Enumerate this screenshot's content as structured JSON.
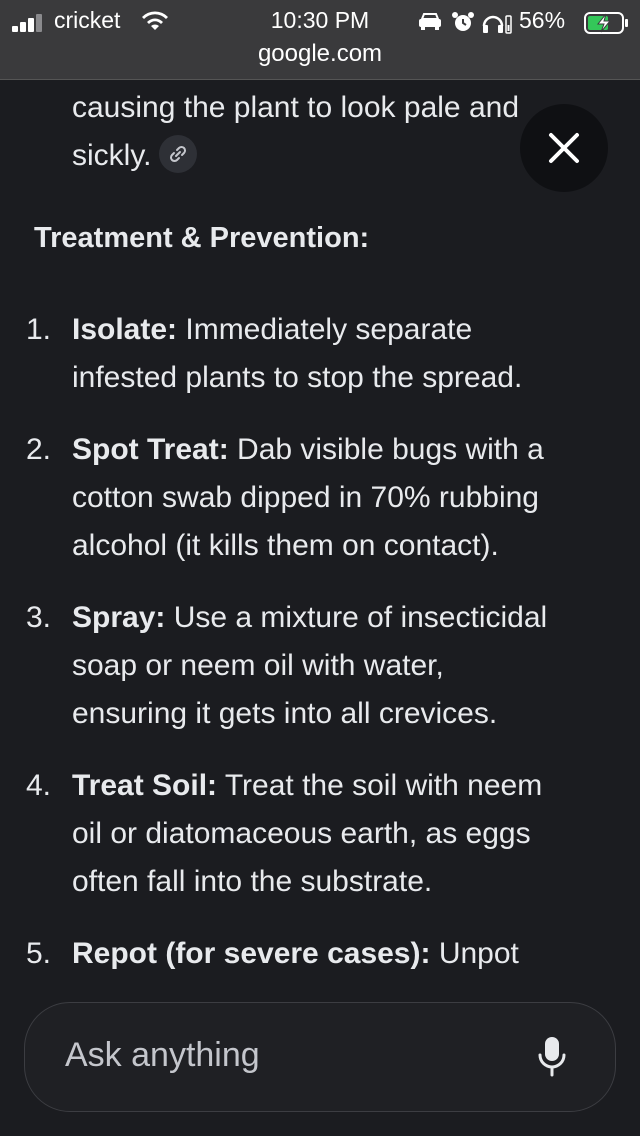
{
  "status_bar": {
    "carrier": "cricket",
    "time": "10:30 PM",
    "battery_percent": "56%",
    "battery_charging": true,
    "url": "google.com",
    "icons": [
      "signal-icon",
      "wifi-icon",
      "car-icon",
      "alarm-icon",
      "headphones-icon",
      "battery-icon"
    ]
  },
  "content": {
    "intro_lines": [
      "causing the plant to look pale and",
      "sickly."
    ],
    "section_heading": "Treatment & Prevention:",
    "items": [
      {
        "number": "1.",
        "title": "Isolate:",
        "lines": [
          " Immediately separate",
          "infested plants to stop the spread."
        ]
      },
      {
        "number": "2.",
        "title": "Spot Treat:",
        "lines": [
          " Dab visible bugs with a",
          "cotton swab dipped in 70% rubbing",
          "alcohol (it kills them on contact)."
        ]
      },
      {
        "number": "3.",
        "title": "Spray:",
        "lines": [
          " Use a mixture of insecticidal",
          "soap or neem oil with water,",
          "ensuring it gets into all crevices."
        ]
      },
      {
        "number": "4.",
        "title": "Treat Soil:",
        "lines": [
          " Treat the soil with neem",
          "oil or diatomaceous earth, as eggs",
          "often fall into the substrate."
        ]
      },
      {
        "number": "5.",
        "title": "Repot (for severe cases):",
        "lines": [
          " Unpot"
        ]
      }
    ]
  },
  "composer": {
    "placeholder": "Ask anything"
  },
  "colors": {
    "background": "#1b1c20",
    "status_bar": "#3a3a3c",
    "text": "#e8eaed",
    "battery_charging": "#34c759"
  }
}
